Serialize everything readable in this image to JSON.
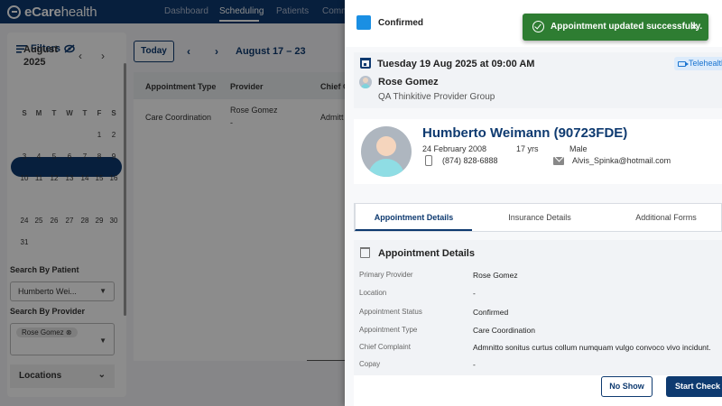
{
  "app": {
    "logo": {
      "brand": "eCare",
      "suffix": "health"
    },
    "nav": [
      "Dashboard",
      "Scheduling",
      "Patients",
      "Comm"
    ],
    "active_nav": "Scheduling"
  },
  "filters": {
    "title": "Filters",
    "calendar": {
      "month": "August",
      "year": "2025",
      "weekdays": [
        "S",
        "M",
        "T",
        "W",
        "T",
        "F",
        "S"
      ],
      "weeks": [
        [
          "",
          "",
          "",
          "",
          "",
          "1",
          "2"
        ],
        [
          "3",
          "4",
          "5",
          "6",
          "7",
          "8",
          "9"
        ],
        [
          "10",
          "11",
          "12",
          "13",
          "14",
          "15",
          "16"
        ],
        [
          "17",
          "18",
          "19",
          "20",
          "21",
          "22",
          "23"
        ],
        [
          "24",
          "25",
          "26",
          "27",
          "28",
          "29",
          "30"
        ],
        [
          "31",
          "",
          "",
          "",
          "",
          "",
          ""
        ]
      ],
      "selected_week_index": 3
    },
    "patient_label": "Search By Patient",
    "patient_value": "Humberto Wei...",
    "provider_label": "Search By Provider",
    "provider_chip": "Rose Gomez",
    "locations_label": "Locations"
  },
  "schedule": {
    "today_label": "Today",
    "range_label": "August 17 – 23",
    "columns": [
      "Appointment Type",
      "Provider",
      "Chief C"
    ],
    "row": {
      "type": "Care Coordination",
      "provider": "Rose Gomez",
      "provider_sub": "-",
      "complaint": "Admitt"
    }
  },
  "drawer": {
    "status": "Confirmed",
    "status_color": "#1a8fe3",
    "datetime": "Tuesday 19 Aug 2025 at 09:00 AM",
    "visit_chip": "Telehealth",
    "provider_name": "Rose Gomez",
    "provider_group": "QA Thinkitive Provider Group",
    "patient": {
      "name": "Humberto Weimann (90723FDE)",
      "dob": "24 February 2008",
      "age": "17 yrs",
      "gender": "Male",
      "phone": "(874) 828-6888",
      "email": "Alvis_Spinka@hotmail.com"
    },
    "tabs": [
      "Appointment Details",
      "Insurance Details",
      "Additional Forms"
    ],
    "active_tab": "Appointment Details",
    "details_title": "Appointment Details",
    "details": [
      {
        "label": "Primary Provider",
        "value": "Rose Gomez"
      },
      {
        "label": "Location",
        "value": "-"
      },
      {
        "label": "Appointment Status",
        "value": "Confirmed"
      },
      {
        "label": "Appointment Type",
        "value": "Care Coordination"
      },
      {
        "label": "Chief Complaint",
        "value": "Admnitto sonitus curtus collum numquam vulgo convoco vivo incidunt."
      },
      {
        "label": "Copay",
        "value": "-"
      }
    ],
    "buttons": {
      "no_show": "No Show",
      "start_check_in": "Start Check In"
    }
  },
  "toast": {
    "message": "Appointment updated successfully.",
    "close": "×",
    "color": "#2e7d32"
  }
}
